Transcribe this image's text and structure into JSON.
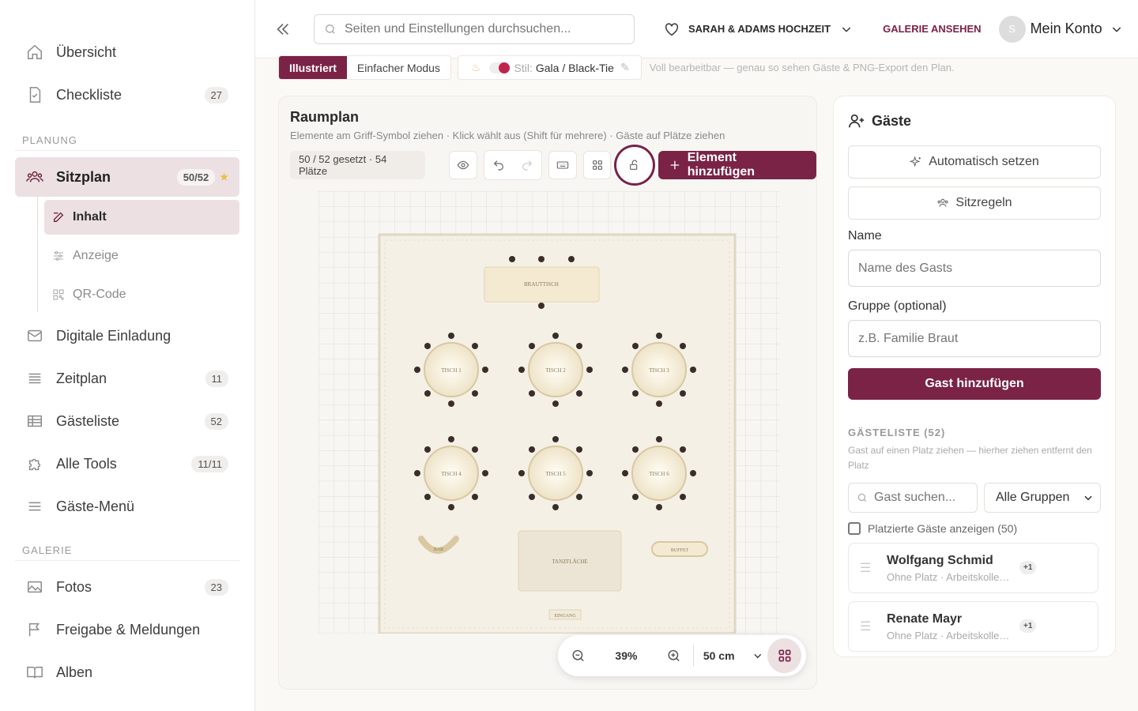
{
  "sidebar": {
    "items_top": [
      {
        "label": "Übersicht",
        "icon": "home-icon"
      },
      {
        "label": "Checkliste",
        "badge": "27",
        "icon": "checklist-icon"
      }
    ],
    "section_planning": "PLANUNG",
    "seating": {
      "label": "Sitzplan",
      "badge": "50/52",
      "star": "★"
    },
    "sub_items": [
      {
        "label": "Inhalt",
        "icon": "edit-icon"
      },
      {
        "label": "Anzeige",
        "icon": "sliders-icon"
      },
      {
        "label": "QR-Code",
        "icon": "qr-icon"
      }
    ],
    "items_planning": [
      {
        "label": "Digitale Einladung",
        "icon": "mail-icon"
      },
      {
        "label": "Zeitplan",
        "badge": "11",
        "icon": "list-icon"
      },
      {
        "label": "Gästeliste",
        "badge": "52",
        "icon": "table-icon"
      },
      {
        "label": "Alle Tools",
        "badge": "11/11",
        "icon": "puzzle-icon"
      },
      {
        "label": "Gäste-Menü",
        "icon": "menu-icon"
      }
    ],
    "section_gallery": "GALERIE",
    "items_gallery": [
      {
        "label": "Fotos",
        "badge": "23",
        "icon": "image-icon"
      },
      {
        "label": "Freigabe & Meldungen",
        "icon": "flag-icon"
      },
      {
        "label": "Alben",
        "icon": "book-icon"
      }
    ]
  },
  "topbar": {
    "search_placeholder": "Seiten und Einstellungen durchsuchen...",
    "wedding_name": "SARAH & ADAMS HOCHZEIT",
    "gallery_link": "GALERIE ANSEHEN",
    "avatar_initial": "S",
    "account_label": "Mein Konto"
  },
  "mode": {
    "tab_illustrated": "Illustriert",
    "tab_simple": "Einfacher Modus",
    "style_key": "Stil:",
    "style_value": "Gala / Black-Tie",
    "hint": "Voll bearbeitbar — genau so sehen Gäste & PNG-Export den Plan."
  },
  "plan": {
    "title": "Raumplan",
    "subtitle": "Elemente am Griff-Symbol ziehen · Klick wählt aus (Shift für mehrere) · Gäste auf Plätze ziehen",
    "count": "50 / 52 gesetzt · 54 Plätze",
    "add_button": "Element hinzufügen",
    "zoom": "39%",
    "grid_unit": "50 cm",
    "labels": {
      "head_table": "BRAUTTISCH",
      "t1": "TISCH 1",
      "t2": "TISCH 2",
      "t3": "TISCH 3",
      "t4": "TISCH 4",
      "t5": "TISCH 5",
      "t6": "TISCH 6",
      "bar": "BAR",
      "buffet": "BUFFET",
      "dance": "TANZFLÄCHE",
      "entrance": "EINGANG"
    }
  },
  "guests": {
    "title": "Gäste",
    "auto_button": "Automatisch setzen",
    "rules_button": "Sitzregeln",
    "name_label": "Name",
    "name_placeholder": "Name des Gasts",
    "group_label": "Gruppe (optional)",
    "group_placeholder": "z.B. Familie Braut",
    "add_button": "Gast hinzufügen",
    "list_title": "GÄSTELISTE (52)",
    "list_hint": "Gast auf einen Platz ziehen — hierher ziehen entfernt den Platz",
    "search_placeholder": "Gast suchen...",
    "group_select": "Alle Gruppen",
    "show_placed": "Platzierte Gäste anzeigen (50)",
    "list": [
      {
        "name": "Wolfgang Schmid",
        "meta": "Ohne Platz · Arbeitskolle…",
        "plus": "+1"
      },
      {
        "name": "Renate Mayr",
        "meta": "Ohne Platz · Arbeitskolle…",
        "plus": "+1"
      }
    ]
  },
  "colors": {
    "accent": "#7a2346",
    "active_bg": "#ece0e3",
    "star": "#e8c23c"
  }
}
